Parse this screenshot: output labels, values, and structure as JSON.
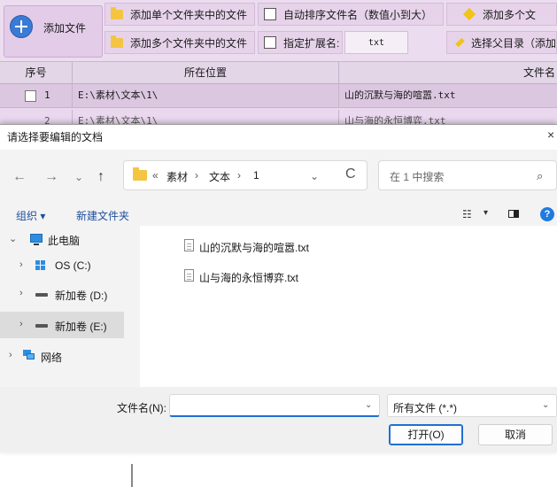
{
  "toolbar": {
    "add_file_label": "添加文件",
    "add_single_folder_label": "添加单个文件夹中的文件",
    "add_multi_folder_label": "添加多个文件夹中的文件",
    "auto_sort_label": "自动排序文件名（数值小到大）",
    "specify_ext_label": "指定扩展名:",
    "ext_value": "txt",
    "add_multi_right_label": "添加多个文",
    "select_parent_label": "选择父目录（添加"
  },
  "grid": {
    "headers": [
      "序号",
      "所在位置",
      "文件名"
    ],
    "rows": [
      {
        "index": "1",
        "location": "E:\\素材\\文本\\1\\",
        "filename": "山的沉默与海的喧嚣.txt"
      },
      {
        "index": "2",
        "location": "E:\\素材\\文本\\1\\",
        "filename": "山与海的永恒博弈.txt"
      }
    ]
  },
  "dialog": {
    "title": "请选择要编辑的文档",
    "close": "×",
    "breadcrumb": {
      "prefix": "«",
      "items": [
        "素材",
        "文本",
        "1"
      ],
      "sep": "›"
    },
    "search_placeholder": "在 1 中搜索",
    "commands": {
      "organize": "组织 ▾",
      "new_folder": "新建文件夹"
    },
    "nav_tree": [
      {
        "label": "此电脑",
        "chev": "⌄"
      },
      {
        "label": "OS (C:)",
        "chev": "›"
      },
      {
        "label": "新加卷 (D:)",
        "chev": "›"
      },
      {
        "label": "新加卷 (E:)",
        "chev": "›"
      },
      {
        "label": "网络",
        "chev": "›"
      }
    ],
    "files": [
      "山的沉默与海的喧嚣.txt",
      "山与海的永恒博弈.txt"
    ],
    "filename_label": "文件名(N):",
    "filename_value": "",
    "file_type": "所有文件 (*.*)",
    "open_button": "打开(O)",
    "cancel_button": "取消"
  },
  "icons": {
    "back": "←",
    "forward": "→",
    "recent": "⌄",
    "up": "↑",
    "refresh": "C",
    "search": "⌕",
    "view": "☷",
    "help": "?"
  },
  "colors": {
    "accent": "#1f6fd1",
    "toolbar_bg": "#ecdcef",
    "row_selected": "#dcc7e1",
    "folder": "#f4c542"
  }
}
